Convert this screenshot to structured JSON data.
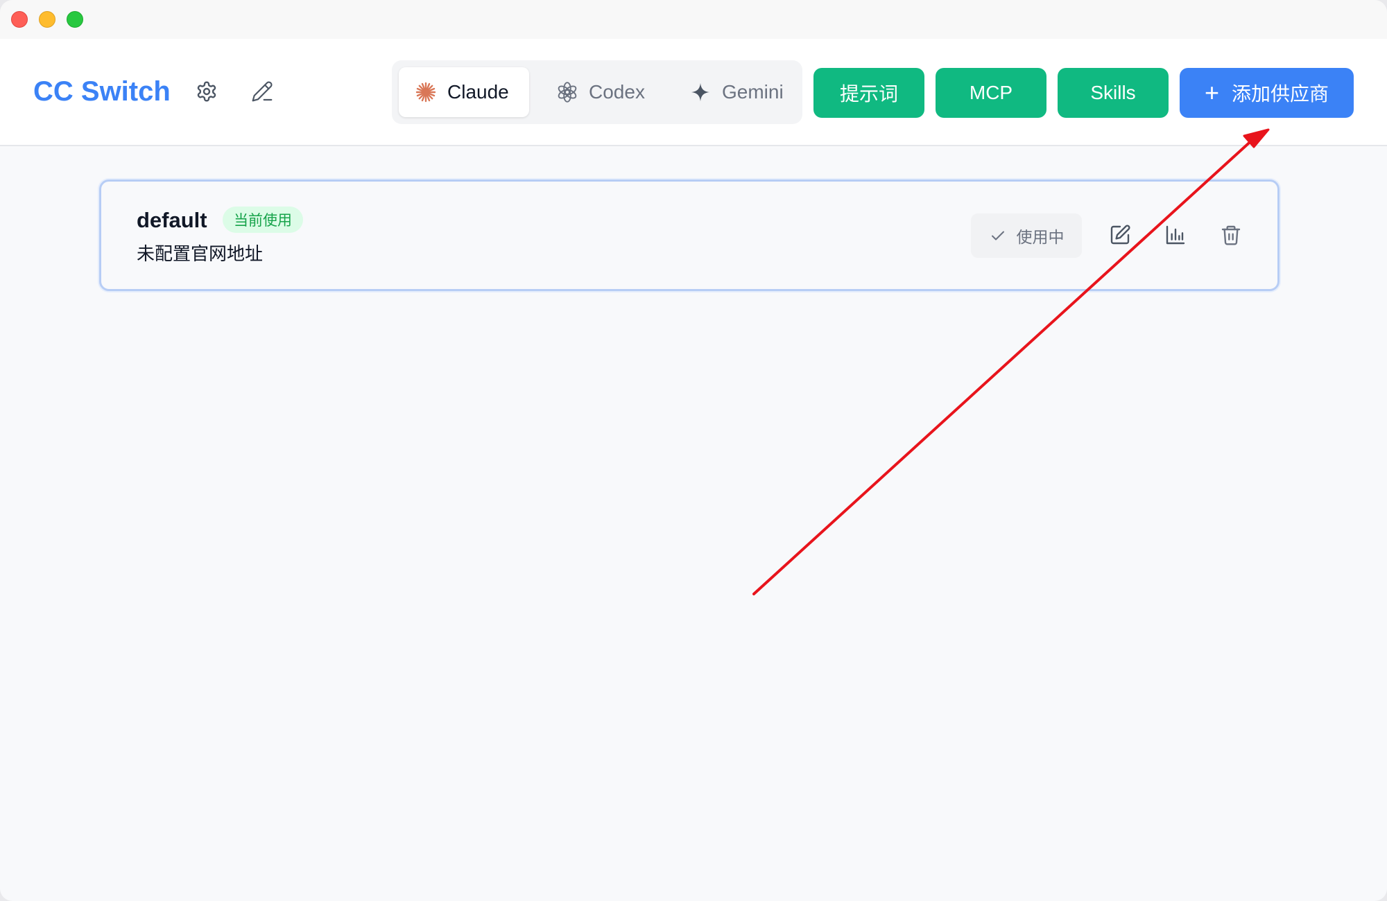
{
  "window": {
    "traffic_lights": [
      "close",
      "minimize",
      "zoom"
    ]
  },
  "header": {
    "title": "CC Switch",
    "settings_icon": "gear-icon",
    "edit_icon": "pencil-icon",
    "tabs": [
      {
        "label": "Claude",
        "icon": "claude-starburst-icon",
        "active": true,
        "icon_color": "#d97757"
      },
      {
        "label": "Codex",
        "icon": "openai-knot-icon",
        "active": false
      },
      {
        "label": "Gemini",
        "icon": "gemini-sparkle-icon",
        "active": false
      }
    ],
    "buttons": {
      "prompts": "提示词",
      "mcp": "MCP",
      "skills": "Skills",
      "add_provider": "添加供应商",
      "add_icon": "+"
    }
  },
  "providers": [
    {
      "name": "default",
      "badge": "当前使用",
      "url_text": "未配置官网地址",
      "status_button": "使用中",
      "actions": [
        "edit-icon",
        "stats-icon",
        "trash-icon"
      ]
    }
  ],
  "colors": {
    "brand_blue": "#3b82f6",
    "action_green": "#10b981",
    "badge_green_bg": "#dcfce7",
    "badge_green_text": "#16a34a",
    "annotation_red": "#e8141c"
  }
}
